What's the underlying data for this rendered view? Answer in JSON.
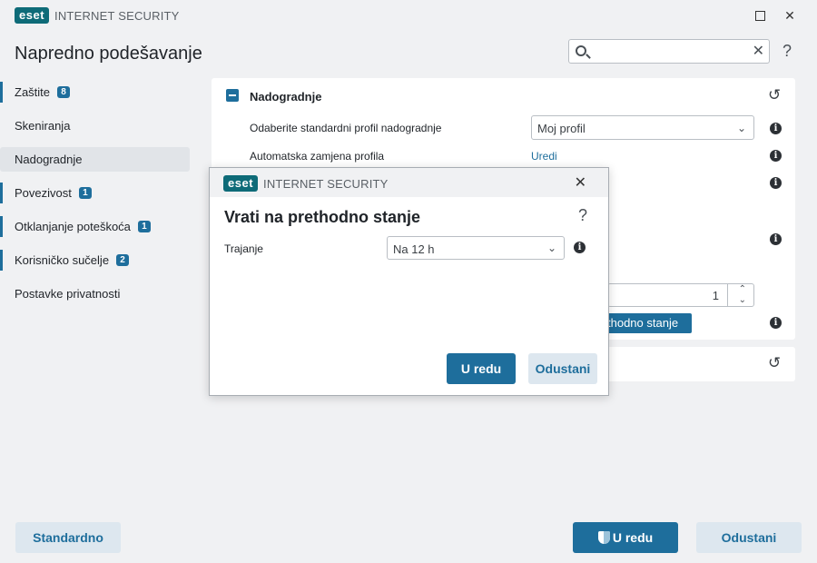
{
  "app": {
    "logo": "eset",
    "product": "INTERNET SECURITY"
  },
  "window": {
    "maximize_icon": "square-icon",
    "close_icon": "close-icon"
  },
  "header": {
    "title": "Napredno podešavanje",
    "search_value": "",
    "help": "?"
  },
  "sidebar": {
    "items": [
      {
        "label": "Zaštite",
        "badge": "8"
      },
      {
        "label": "Skeniranja",
        "badge": ""
      },
      {
        "label": "Nadogradnje",
        "badge": ""
      },
      {
        "label": "Povezivost",
        "badge": "1"
      },
      {
        "label": "Otklanjanje poteškoća",
        "badge": "1"
      },
      {
        "label": "Korisničko sučelje",
        "badge": "2"
      },
      {
        "label": "Postavke privatnosti",
        "badge": ""
      }
    ]
  },
  "main": {
    "section_title": "Nadogradnje",
    "rows": [
      {
        "label": "Odaberite standardni profil nadogradnje",
        "value": "Moj profil"
      },
      {
        "label": "Automatska zamjena profila",
        "value": "Uredi"
      }
    ],
    "stepper_value": "1",
    "partial_button": "thodno stanje"
  },
  "dialog": {
    "logo": "eset",
    "product": "INTERNET SECURITY",
    "title": "Vrati na prethodno stanje",
    "help": "?",
    "field_label": "Trajanje",
    "field_value": "Na 12 h",
    "ok": "U redu",
    "cancel": "Odustani"
  },
  "footer": {
    "default_button": "Standardno",
    "ok_button": "U redu",
    "cancel_button": "Odustani"
  },
  "colors": {
    "accent": "#1e6e9c",
    "logo": "#0e6b78",
    "background": "#f0f1f3"
  }
}
